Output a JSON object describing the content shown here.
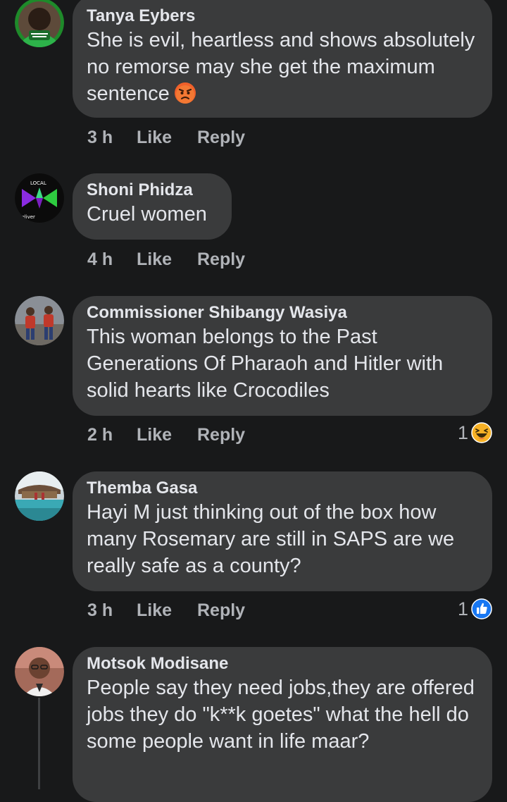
{
  "comments": [
    {
      "author": "Tanya Eybers",
      "text": "She is evil, heartless and shows absolutely no remorse may she get the maximum sentence",
      "emoji": "angry-face",
      "time": "3 h",
      "like_label": "Like",
      "reply_label": "Reply"
    },
    {
      "author": "Shoni Phidza",
      "text": "Cruel women",
      "time": "4 h",
      "like_label": "Like",
      "reply_label": "Reply"
    },
    {
      "author": "Commissioner Shibangy Wasiya",
      "text": "This woman belongs to the Past Generations Of Pharaoh and Hitler with solid hearts like Crocodiles",
      "time": "2 h",
      "like_label": "Like",
      "reply_label": "Reply",
      "reaction_count": "1",
      "reaction_type": "haha"
    },
    {
      "author": "Themba Gasa",
      "text": "Hayi M just thinking out of the box how many Rosemary are still in SAPS are we really safe as a county?",
      "time": "3 h",
      "like_label": "Like",
      "reply_label": "Reply",
      "reaction_count": "1",
      "reaction_type": "like"
    },
    {
      "author": "Motsok Modisane",
      "text": "People say they need jobs,they are offered jobs they do \"k**k goetes\" what the hell do some people want in life maar?"
    }
  ],
  "colors": {
    "background": "#18191a",
    "bubble": "#3a3b3c",
    "primary_text": "#e4e6eb",
    "secondary_text": "#b0b3b8",
    "like_blue": "#1877f2"
  }
}
